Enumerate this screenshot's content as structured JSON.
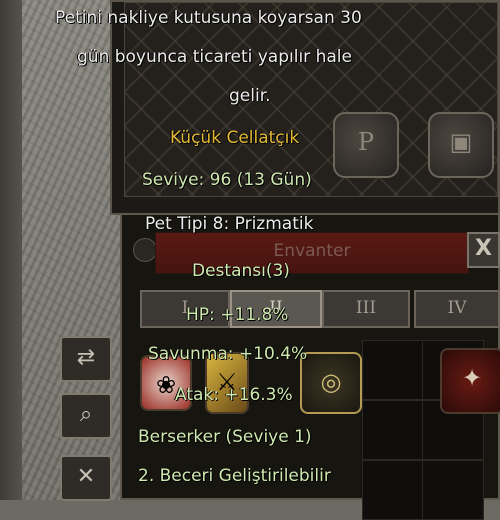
{
  "tooltip": {
    "description_line1": "Petini nakliye kutusuna koyarsan 30",
    "description_line2": "gün boyunca ticareti yapılır hale",
    "description_line3": "gelir.",
    "item_name": "Küçük Cellatçık",
    "level_line": "Seviye: 96 (13 Gün)",
    "pet_type": "Pet Tipi 8: Prizmatik",
    "rarity": "Destansı(3)",
    "hp_bonus": "HP: +11.8%",
    "defense_bonus": "Savunma: +10.4%",
    "attack_bonus": "Atak: +16.3%",
    "skill": "Berserker (Seviye 1)",
    "skill_note": "2. Beceri Geliştirilebilir"
  },
  "pet_window": {
    "title": "Envanter",
    "close_label": "X",
    "tabs": [
      "I",
      "II",
      "III",
      "IV"
    ],
    "active_tab": "II"
  },
  "side_buttons": {
    "swap_icon": "swap-arrows-icon",
    "search_icon": "magnifier-icon",
    "close_icon": "close-icon"
  },
  "bg_inventory": {
    "slot_letter": "P"
  },
  "colors": {
    "item_name": "#e5bb35",
    "stat_text": "#cfe9b0",
    "title_bar": "#4e1712"
  }
}
